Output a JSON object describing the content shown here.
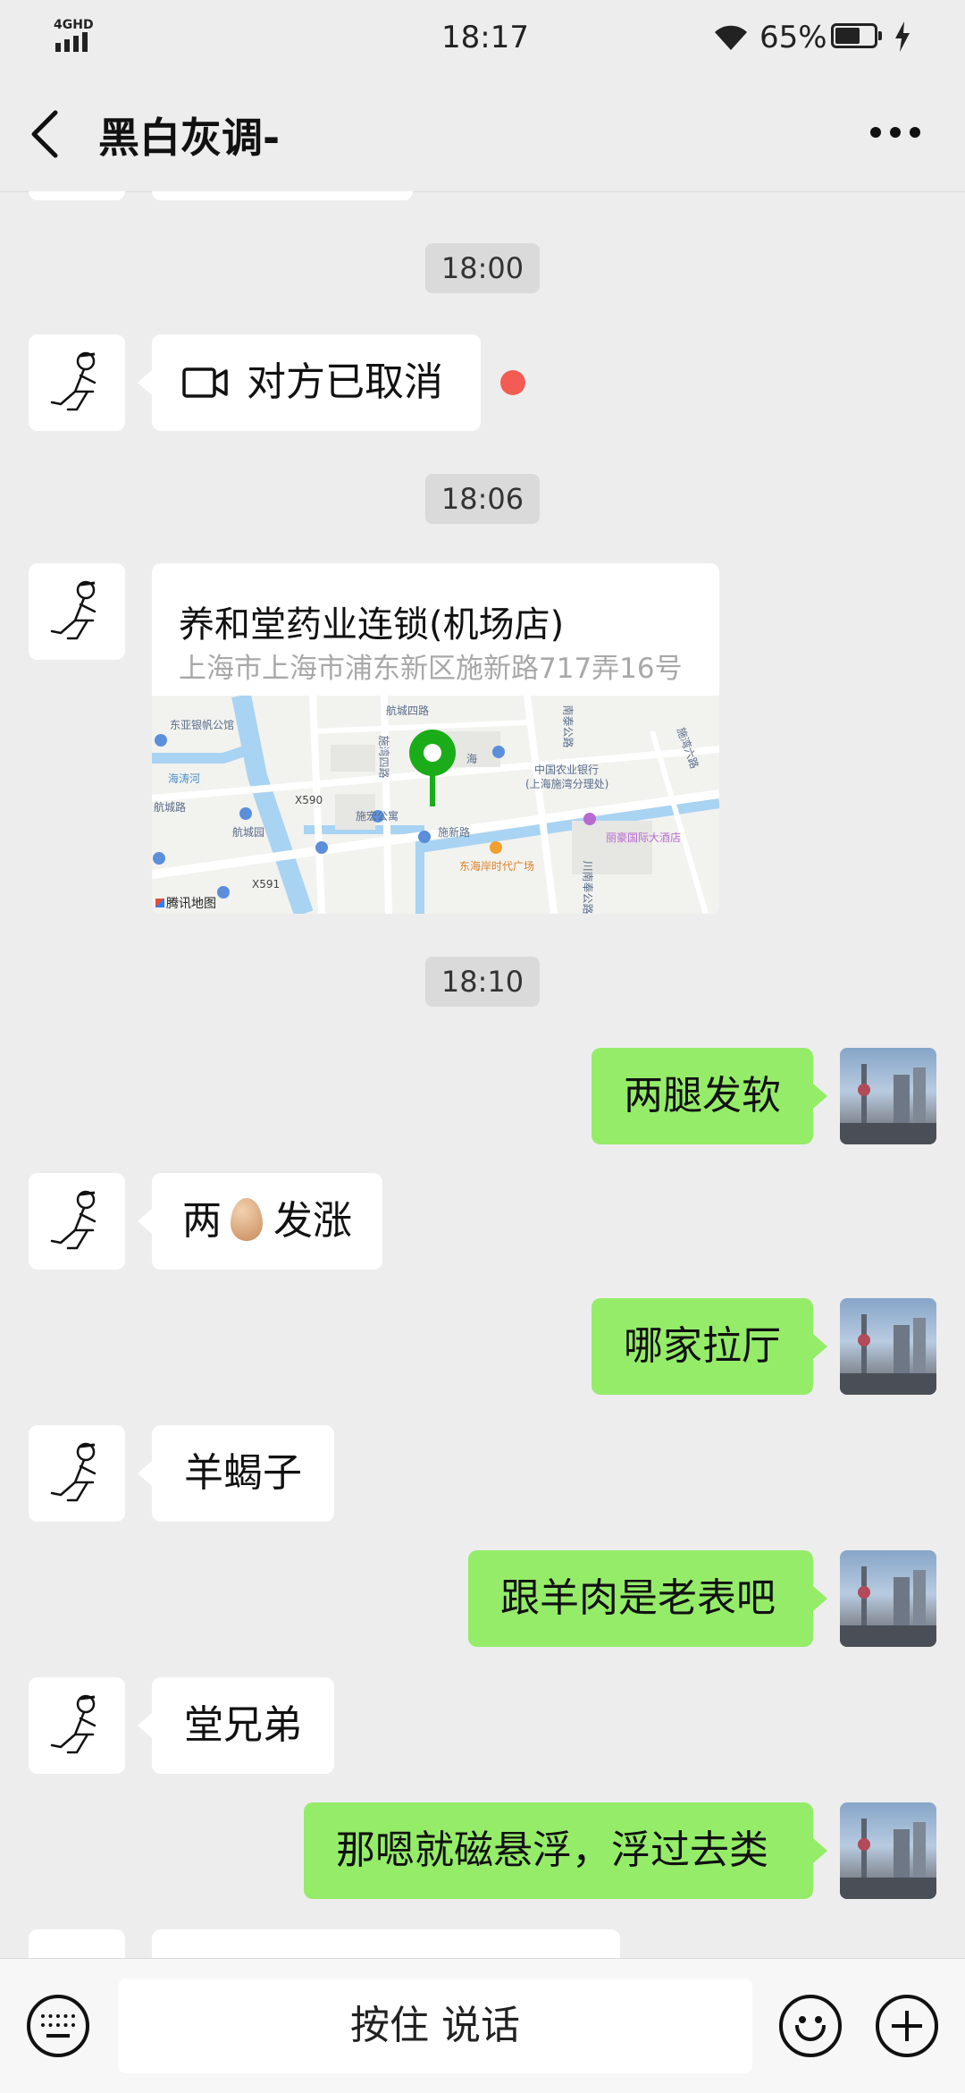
{
  "status_bar": {
    "network": "4GHD",
    "time": "18:17",
    "battery_percent": "65%",
    "battery_level": 0.65
  },
  "header": {
    "title": "黑白灰调-",
    "back_icon": "chevron-left-icon",
    "more_icon": "more-dots-icon"
  },
  "messages": {
    "t1": "18:00",
    "call_text": "对方已取消",
    "t2": "18:06",
    "location": {
      "name": "养和堂药业连锁(机场店)",
      "address": "上海市上海市浦东新区施新路717弄16号",
      "map": {
        "labels": [
          "东亚银帆公馆",
          "海涛河",
          "航城路",
          "航城园",
          "X590",
          "X591",
          "航城四路",
          "施湾四路",
          "施宏公寓",
          "施新路",
          "东海岸时代广场",
          "中国农业银行",
          "(上海施湾分理处)",
          "丽豪国际大酒店",
          "南泰公路",
          "川南奉公路",
          "施湾六路",
          "海"
        ],
        "brand": "腾讯地图"
      }
    },
    "t3": "18:10",
    "m1": "两腿发软",
    "m2_a": "两",
    "m2_b": "发涨",
    "m3": "哪家拉厅",
    "m4": "羊蝎子",
    "m5": "跟羊肉是老表吧",
    "m6": "堂兄弟",
    "m7": "那嗯就磁悬浮，浮过去类"
  },
  "input_bar": {
    "hold_to_talk": "按住 说话",
    "left_icon": "keyboard-icon",
    "emoji_icon": "emoji-icon",
    "plus_icon": "plus-icon"
  },
  "colors": {
    "background": "#EDEDED",
    "outgoing_bubble": "#95EC69",
    "incoming_bubble": "#FFFFFF",
    "unread_dot": "#F25C54",
    "map_pin": "#1AAD19"
  }
}
